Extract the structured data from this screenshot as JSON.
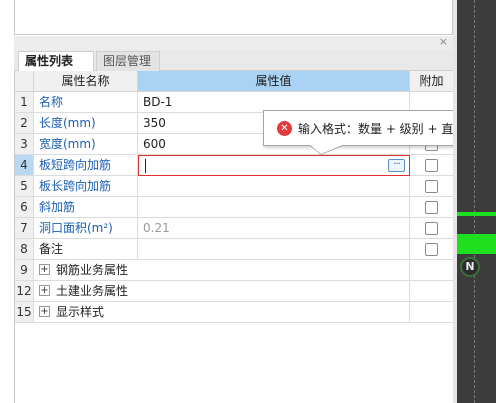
{
  "tabs": {
    "properties": "属性列表",
    "layers": "图层管理"
  },
  "headers": {
    "name": "属性名称",
    "value": "属性值",
    "add": "附加"
  },
  "rows": [
    {
      "num": "1",
      "name": "名称",
      "value": "BD-1"
    },
    {
      "num": "2",
      "name": "长度(mm)",
      "value": "350"
    },
    {
      "num": "3",
      "name": "宽度(mm)",
      "value": "600"
    },
    {
      "num": "4",
      "name": "板短跨向加筋",
      "value": ""
    },
    {
      "num": "5",
      "name": "板长跨向加筋",
      "value": ""
    },
    {
      "num": "6",
      "name": "斜加筋",
      "value": ""
    },
    {
      "num": "7",
      "name": "洞口面积(m²)",
      "value": "0.21"
    },
    {
      "num": "8",
      "name": "备注",
      "value": ""
    }
  ],
  "groups": [
    {
      "num": "9",
      "label": "钢筋业务属性",
      "expander": "+"
    },
    {
      "num": "12",
      "label": "土建业务属性",
      "expander": "+"
    },
    {
      "num": "15",
      "label": "显示样式",
      "expander": "+"
    }
  ],
  "editor": {
    "more": "···"
  },
  "tooltip": {
    "text": "输入格式：数量 + 级别 + 直径。如："
  },
  "panel": {
    "close": "×"
  },
  "compass": {
    "north": "N"
  },
  "colors": {
    "header_value_bg": "#a9d2f3",
    "error_border": "#e03030",
    "accent_green": "#1fe01f"
  }
}
